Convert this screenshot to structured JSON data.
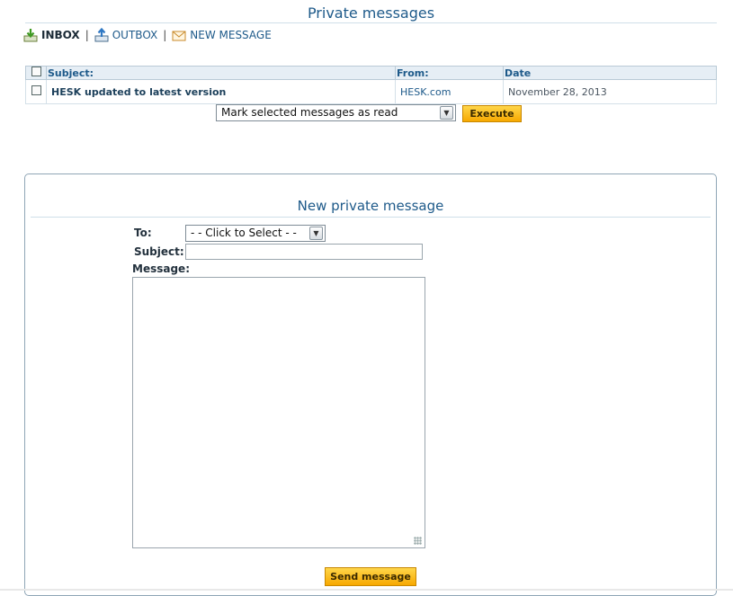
{
  "header": {
    "title": "Private messages"
  },
  "nav": {
    "inbox": "INBOX",
    "outbox": "OUTBOX",
    "new_message": "NEW MESSAGE",
    "separator": "|"
  },
  "table": {
    "columns": {
      "subject": "Subject:",
      "from": "From:",
      "date": "Date"
    },
    "rows": [
      {
        "subject": "HESK updated to latest version",
        "from": "HESK.com",
        "date": "November 28, 2013"
      }
    ]
  },
  "bulk_action": {
    "selected": "Mark selected messages as read",
    "execute_label": "Execute"
  },
  "compose": {
    "title": "New private message",
    "to_label": "To:",
    "to_selected": "- - Click to Select - -",
    "subject_label": "Subject:",
    "subject_value": "",
    "message_label": "Message:",
    "message_value": "",
    "send_label": "Send message"
  },
  "colors": {
    "accent": "#1e5a8a",
    "button": "#f7a800",
    "header_bg": "#e6eef5"
  }
}
